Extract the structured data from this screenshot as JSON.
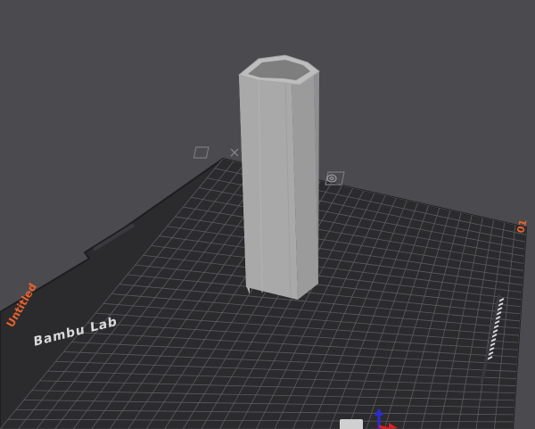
{
  "viewport": {
    "background": "#4a4a4f",
    "plate_color": "#2b2b2e",
    "grid_color": "#5b5b60",
    "accent": "#e8622b"
  },
  "plate": {
    "brand": "Bambu Lab",
    "plate_name": "Untitled",
    "plate_number": "01"
  },
  "plate_controls": [
    {
      "name": "close-plate-button",
      "icon": "close-icon"
    },
    {
      "name": "arrange-plate-button",
      "icon": "target-icon"
    }
  ],
  "model": {
    "shape": "hollow-octagonal-tube",
    "color": "#a9a9a9"
  },
  "axes": {
    "x_color": "#d92020",
    "y_color": "#23a023",
    "z_color": "#2b2bd9"
  }
}
